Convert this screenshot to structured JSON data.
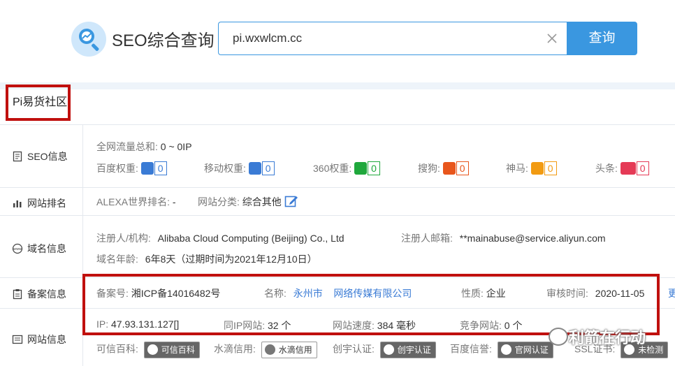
{
  "app": {
    "title": "SEO综合查询"
  },
  "search": {
    "value": "pi.wxwlcm.cc",
    "button_label": "查询"
  },
  "site_name": "Pi易货社区",
  "sidebar": {
    "items": [
      {
        "label": "SEO信息",
        "icon": "doc-icon"
      },
      {
        "label": "网站排名",
        "icon": "bar-chart-icon"
      },
      {
        "label": "域名信息",
        "icon": "www-icon"
      },
      {
        "label": "备案信息",
        "icon": "clipboard-icon"
      },
      {
        "label": "网站信息",
        "icon": "list-icon"
      }
    ]
  },
  "seo": {
    "traffic_label": "全网流量总和:",
    "traffic_value": "0 ~ 0IP",
    "weights": [
      {
        "label": "百度权重:",
        "value": "0",
        "color": "#3a7bd5",
        "icon": "baidu-paw-icon"
      },
      {
        "label": "移动权重:",
        "value": "0",
        "color": "#3a7bd5",
        "icon": "baidu-paw-icon"
      },
      {
        "label": "360权重:",
        "value": "0",
        "color": "#1fa83c",
        "icon": "360-icon"
      },
      {
        "label": "搜狗:",
        "value": "0",
        "color": "#e8561c",
        "icon": "sogou-icon"
      },
      {
        "label": "神马:",
        "value": "0",
        "color": "#f29b12",
        "icon": "shenma-icon"
      },
      {
        "label": "头条:",
        "value": "0",
        "color": "#e53a56",
        "icon": "toutiao-icon"
      }
    ]
  },
  "ranking": {
    "alexa_label": "ALEXA世界排名:",
    "alexa_value": "-",
    "category_label": "网站分类:",
    "category_value": "综合其他"
  },
  "domain": {
    "registrant_label": "注册人/机构:",
    "registrant_value": "Alibaba Cloud Computing (Beijing) Co., Ltd",
    "email_label": "注册人邮箱:",
    "email_value": "**mainabuse@service.aliyun.com",
    "age_label": "域名年龄:",
    "age_value": "6年8天（过期时间为2021年12月10日）"
  },
  "icp": {
    "number_label": "备案号:",
    "number_value": "湘ICP备14016482号",
    "name_label": "名称:",
    "name_value": "永州市    网络传媒有限公司",
    "nature_label": "性质:",
    "nature_value": "企业",
    "audit_label": "审核时间:",
    "audit_value": "2020-11-05",
    "more": "更"
  },
  "site_info": {
    "ip_label": "IP:",
    "ip_value": "47.93.131.127[]",
    "same_ip_label": "同IP网站:",
    "same_ip_value": "32 个",
    "speed_label": "网站速度:",
    "speed_value": "384 毫秒",
    "competitor_label": "竞争网站:",
    "competitor_value": "0 个"
  },
  "certs": [
    {
      "label": "可信百科:",
      "badge": "可信百科"
    },
    {
      "label": "水滴信用:",
      "badge": "水滴信用"
    },
    {
      "label": "创宇认证:",
      "badge": "创宇认证"
    },
    {
      "label": "百度信誉:",
      "badge": "官网认证"
    },
    {
      "label": "SSL证书:",
      "badge": "未检测"
    }
  ],
  "watermark": "利箭在行动"
}
